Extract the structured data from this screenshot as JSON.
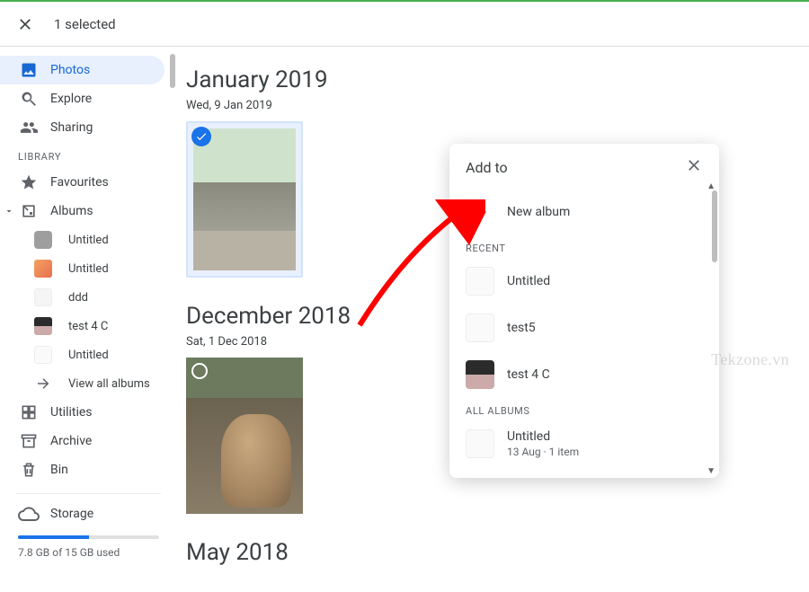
{
  "header": {
    "selected_text": "1 selected"
  },
  "sidebar": {
    "items": [
      {
        "label": "Photos"
      },
      {
        "label": "Explore"
      },
      {
        "label": "Sharing"
      }
    ],
    "library_label": "LIBRARY",
    "library_items": [
      {
        "label": "Favourites"
      },
      {
        "label": "Albums"
      }
    ],
    "albums": [
      {
        "label": "Untitled"
      },
      {
        "label": "Untitled"
      },
      {
        "label": "ddd"
      },
      {
        "label": "test 4 C"
      },
      {
        "label": "Untitled"
      }
    ],
    "view_all": "View all albums",
    "utilities": "Utilities",
    "archive": "Archive",
    "bin": "Bin",
    "storage_label": "Storage",
    "storage_used": "7.8 GB of 15 GB used"
  },
  "main": {
    "groups": [
      {
        "month": "January 2019",
        "date": "Wed, 9 Jan 2019"
      },
      {
        "month": "December 2018",
        "date": "Sat, 1 Dec 2018"
      },
      {
        "month": "May 2018"
      }
    ]
  },
  "dialog": {
    "title": "Add to",
    "new_album": "New album",
    "recent_label": "RECENT",
    "recent": [
      {
        "label": "Untitled"
      },
      {
        "label": "test5"
      },
      {
        "label": "test 4 C"
      }
    ],
    "all_label": "ALL ALBUMS",
    "all": [
      {
        "label": "Untitled",
        "sub": "13 Aug  ·  1 item"
      }
    ]
  },
  "watermark": "Tekzone.vn"
}
